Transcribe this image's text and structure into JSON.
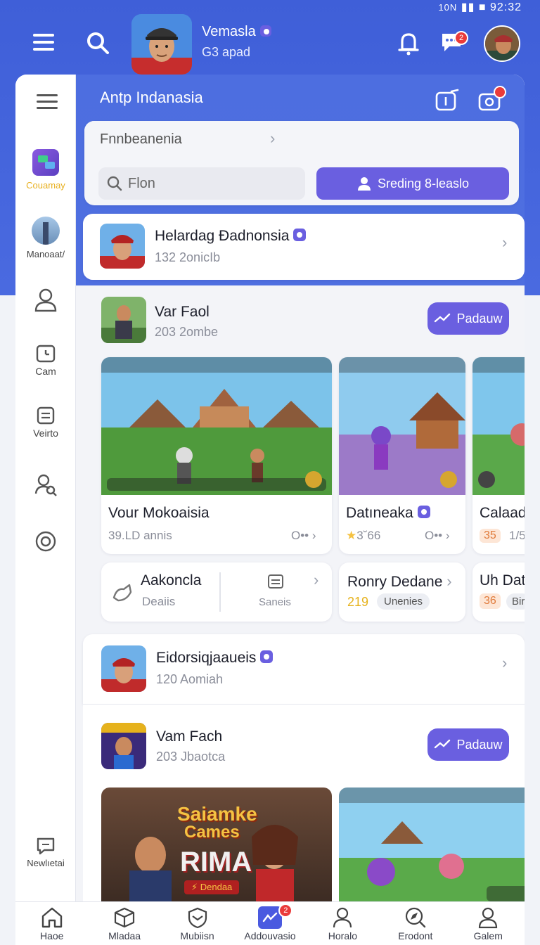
{
  "status_bar": {
    "network": "10N",
    "time": "92:32"
  },
  "header": {
    "name": "Vemasla",
    "subtitle": "G3 apad",
    "chat_badge": "2"
  },
  "sidebar": {
    "items": [
      {
        "label": "Couamay",
        "icon": "game-grid-icon"
      },
      {
        "label": "Manoaat/",
        "icon": "city-avatar-icon"
      },
      {
        "label": "",
        "icon": "users-icon"
      },
      {
        "label": "Cam",
        "icon": "calendar-icon"
      },
      {
        "label": "Veirto",
        "icon": "document-icon"
      },
      {
        "label": "",
        "icon": "user-search-icon"
      },
      {
        "label": "",
        "icon": "settings-icon"
      },
      {
        "label": "Newlıetai",
        "icon": "message-icon"
      }
    ]
  },
  "content": {
    "title": "Antp Indanasia",
    "tab_label": "Fnnbeanenia",
    "search_placeholder": "Flon",
    "primary_button": "Sreding 8-leaslo",
    "sections": [
      {
        "group_name": "Helardag Đadnonsia",
        "group_count": "132 2onicIb",
        "user_name": "Var Faol",
        "user_meta": "203 2ombe",
        "follow_label": "Padauw",
        "games": [
          {
            "title": "Vour Mokoaisia",
            "meta": "39.LD annis",
            "more": "O••",
            "theme": "green"
          },
          {
            "title": "Datıneaka",
            "meta": "3˘66",
            "more": "O••",
            "theme": "purple",
            "verified": true
          },
          {
            "title": "Calaad",
            "meta": "35",
            "more": "1/5",
            "theme": "tropic"
          }
        ],
        "extras": [
          {
            "title": "Aakoncla",
            "sub": "Deaiis",
            "side": "Saneis"
          },
          {
            "title": "Ronry Dedane",
            "count": "219",
            "chip": "Unenies"
          },
          {
            "title": "Uh Dat",
            "count": "36",
            "chip": "Bir"
          }
        ]
      },
      {
        "group_name": "Eidorsiqjaaueis",
        "group_count": "120 Aomiah",
        "user_name": "Vam Fach",
        "user_meta": "203 Jbaotca",
        "follow_label": "Padauw",
        "promo": {
          "line1": "Saiamke",
          "line2": "Cames",
          "line3": "RIMA",
          "ribbon": "⚡ Dendaa"
        }
      }
    ]
  },
  "bottom_nav": [
    {
      "label": "Haoe",
      "icon": "home-icon"
    },
    {
      "label": "Mladaa",
      "icon": "cube-icon"
    },
    {
      "label": "Mubiisn",
      "icon": "shield-icon"
    },
    {
      "label": "Addouvasio",
      "icon": "game-controller-icon",
      "badge": "2",
      "active": true
    },
    {
      "label": "Horalo",
      "icon": "user-icon"
    },
    {
      "label": "Erodont",
      "icon": "compass-icon"
    },
    {
      "label": "Galem",
      "icon": "profile-icon"
    }
  ],
  "colors": {
    "primary": "#4a6ae0",
    "accent": "#6a5fe0",
    "badge": "#ea3b3b",
    "star": "#f5c242"
  }
}
